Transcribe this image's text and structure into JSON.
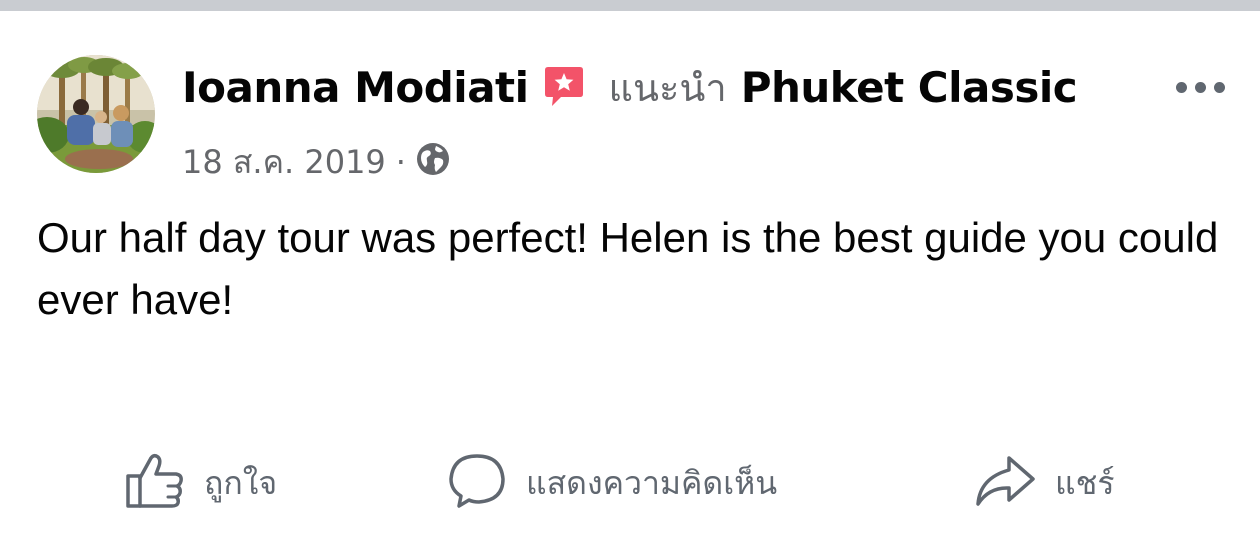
{
  "post": {
    "author_name": "Ioanna Modiati",
    "recommends_text": "แนะนำ",
    "page_name": "Phuket Classic",
    "date": "18 ส.ค. 2019",
    "separator": "·",
    "privacy_icon": "globe-icon",
    "recommendation_icon": "recommendation-star-icon",
    "body_text": "Our half day tour was perfect! Helen is the best guide you could ever have!"
  },
  "actions": {
    "like_label": "ถูกใจ",
    "comment_label": "แสดงความคิดเห็น",
    "share_label": "แชร์"
  },
  "colors": {
    "recommend_badge": "#f35369",
    "secondary_text": "#65676b",
    "primary_text": "#050505",
    "divider": "#c9ccd1"
  }
}
